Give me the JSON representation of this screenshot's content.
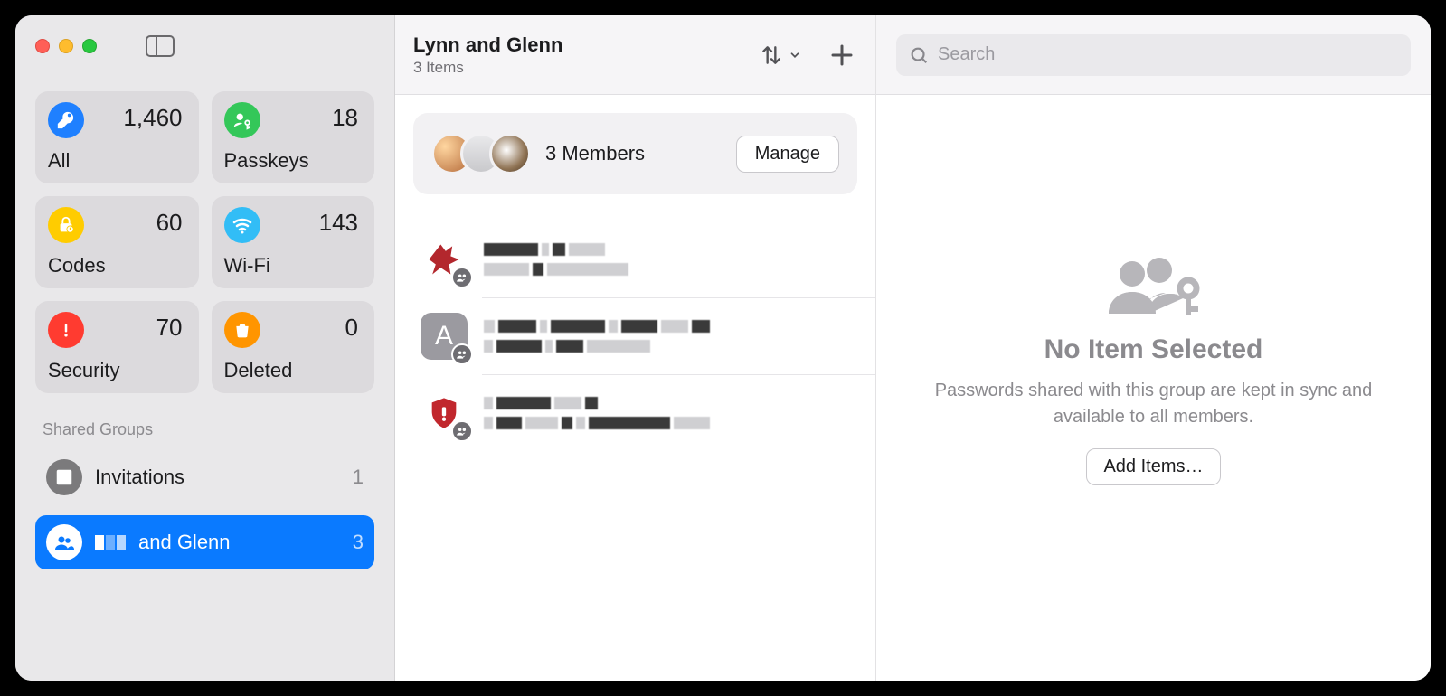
{
  "sidebar": {
    "tiles": [
      {
        "id": "all",
        "label": "All",
        "count": "1,460"
      },
      {
        "id": "passkeys",
        "label": "Passkeys",
        "count": "18"
      },
      {
        "id": "codes",
        "label": "Codes",
        "count": "60"
      },
      {
        "id": "wifi",
        "label": "Wi-Fi",
        "count": "143"
      },
      {
        "id": "security",
        "label": "Security",
        "count": "70"
      },
      {
        "id": "deleted",
        "label": "Deleted",
        "count": "0"
      }
    ],
    "shared_groups_header": "Shared Groups",
    "invitations": {
      "label": "Invitations",
      "count": "1"
    },
    "group_selected": {
      "label_suffix": "and Glenn",
      "count": "3"
    }
  },
  "middle": {
    "title": "Lynn and Glenn",
    "subtitle": "3 Items",
    "members_text": "3 Members",
    "manage_label": "Manage"
  },
  "detail": {
    "search_placeholder": "Search",
    "empty_title": "No Item Selected",
    "empty_desc": "Passwords shared with this group are kept in sync and available to all members.",
    "add_items_label": "Add Items…"
  },
  "colors": {
    "accent": "#0a7aff"
  }
}
